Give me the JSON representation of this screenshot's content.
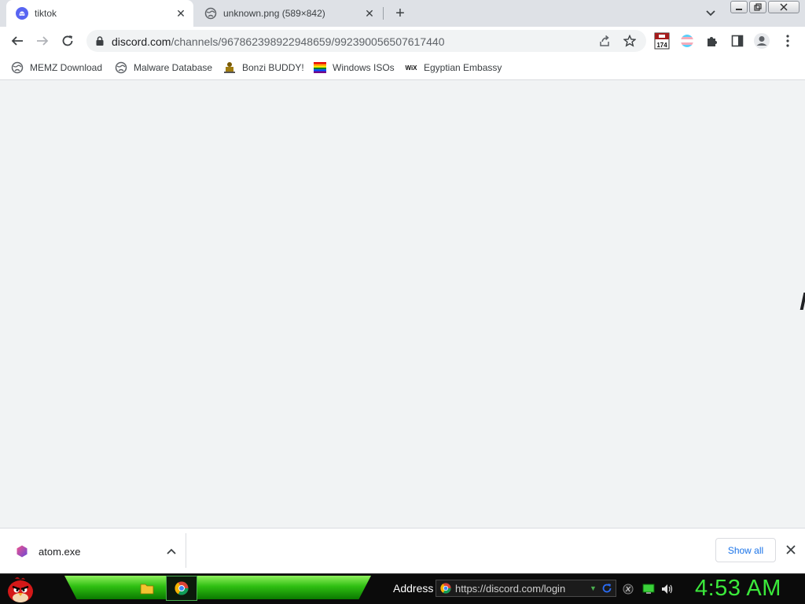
{
  "tabs": [
    {
      "title": "tiktok",
      "favicon": "discord-icon",
      "active": true
    },
    {
      "title": "unknown.png (589×842)",
      "favicon": "globe-icon",
      "active": false
    }
  ],
  "omnibox": {
    "domain": "discord.com",
    "path": "/channels/967862398922948659/992390056507617440"
  },
  "extensions": {
    "calendar_badge": "174"
  },
  "bookmarks": [
    {
      "label": "MEMZ Download",
      "icon": "globe-icon"
    },
    {
      "label": "Malware Database",
      "icon": "globe-icon"
    },
    {
      "label": "Bonzi BUDDY!",
      "icon": "bonzi-icon"
    },
    {
      "label": "Windows ISOs",
      "icon": "rainbow-flag-icon"
    },
    {
      "label": "Egyptian Embassy",
      "icon": "wix-icon"
    }
  ],
  "wix_text": "WiX",
  "download": {
    "filename": "atom.exe",
    "show_all_label": "Show all"
  },
  "taskbar": {
    "address_label": "Address",
    "address_url": "https://discord.com/login",
    "clock": "4:53 AM"
  },
  "colors": {
    "discord": "#5865f2",
    "link_blue": "#1a73e8",
    "clock_green": "#3be93b",
    "taskbar_green": "#2fbf12"
  }
}
